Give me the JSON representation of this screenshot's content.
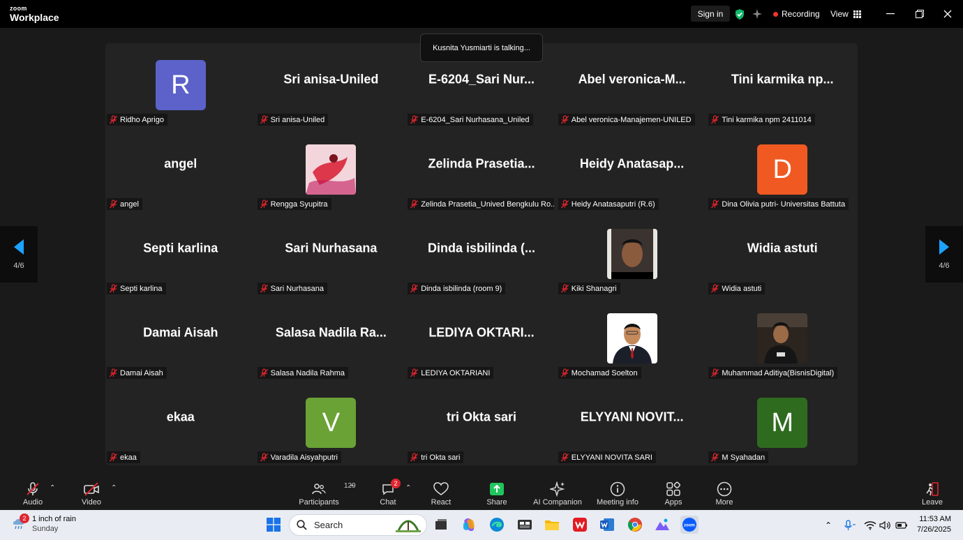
{
  "app": {
    "logo_top": "zoom",
    "logo_bottom": "Workplace"
  },
  "topbar": {
    "sign_in": "Sign in",
    "recording": "Recording",
    "view": "View"
  },
  "talking_toast": "Kusnita Yusmiarti is talking...",
  "pager": {
    "left": "4/6",
    "right": "4/6"
  },
  "tiles": [
    {
      "big": "",
      "avatar": "R",
      "avatar_color": "#5c62c9",
      "name": "Ridho Aprigo"
    },
    {
      "big": "Sri anisa-Uniled",
      "name": "Sri anisa-Uniled"
    },
    {
      "big": "E-6204_Sari Nur...",
      "name": "E-6204_Sari Nurhasana_Uniled"
    },
    {
      "big": "Abel veronica-M...",
      "name": "Abel veronica-Manajemen-UNILED"
    },
    {
      "big": "Tini karmika np...",
      "name": "Tini karmika npm 2411014"
    },
    {
      "big": "angel",
      "name": "angel"
    },
    {
      "big": "",
      "photo": "red-figure",
      "name": "Rengga Syupitra"
    },
    {
      "big": "Zelinda Prasetia...",
      "name": "Zelinda Prasetia_Unived Bengkulu Ro..."
    },
    {
      "big": "Heidy Anatasap...",
      "name": "Heidy Anatasaputri (R.6)"
    },
    {
      "big": "",
      "avatar": "D",
      "avatar_color": "#f05a22",
      "name": "Dina Olivia putri- Universitas Battuta"
    },
    {
      "big": "Septi karlina",
      "name": "Septi karlina"
    },
    {
      "big": "Sari Nurhasana",
      "name": "Sari Nurhasana"
    },
    {
      "big": "Dinda isbilinda (...",
      "name": "Dinda isbilinda (room 9)"
    },
    {
      "big": "",
      "photo": "man-video",
      "name": "Kiki Shanagri"
    },
    {
      "big": "Widia astuti",
      "name": "Widia astuti"
    },
    {
      "big": "Damai Aisah",
      "name": "Damai Aisah"
    },
    {
      "big": "Salasa Nadila Ra...",
      "name": "Salasa Nadila Rahma"
    },
    {
      "big": "LEDIYA OKTARI...",
      "name": "LEDIYA OKTARIANI"
    },
    {
      "big": "",
      "photo": "man-suit",
      "name": "Mochamad Soelton"
    },
    {
      "big": "",
      "photo": "man-dark",
      "name": "Muhammad Aditiya(BisnisDigital)"
    },
    {
      "big": "ekaa",
      "name": "ekaa"
    },
    {
      "big": "",
      "avatar": "V",
      "avatar_color": "#6aa236",
      "name": "Varadila Aisyahputri"
    },
    {
      "big": "tri Okta sari",
      "name": "tri Okta sari"
    },
    {
      "big": "ELYYANI NOVIT...",
      "name": "ELYYANI NOVITA SARI"
    },
    {
      "big": "",
      "avatar": "M",
      "avatar_color": "#2f6b1f",
      "name": "M Syahadan"
    }
  ],
  "toolbar": {
    "audio": "Audio",
    "video": "Video",
    "participants": "Participants",
    "participants_count": "129",
    "chat": "Chat",
    "chat_badge": "2",
    "react": "React",
    "share": "Share",
    "ai_companion": "AI Companion",
    "meeting_info": "Meeting info",
    "apps": "Apps",
    "more": "More",
    "leave": "Leave"
  },
  "taskbar": {
    "weather_badge": "2",
    "weather_line1": "1 inch of rain",
    "weather_line2": "Sunday",
    "search": "Search",
    "time": "11:53 AM",
    "date": "7/26/2025"
  },
  "colors": {
    "accent_green": "#12b76a",
    "share_green": "#22c55e",
    "record_red": "#f0352f",
    "muted_red": "#e0262f"
  }
}
